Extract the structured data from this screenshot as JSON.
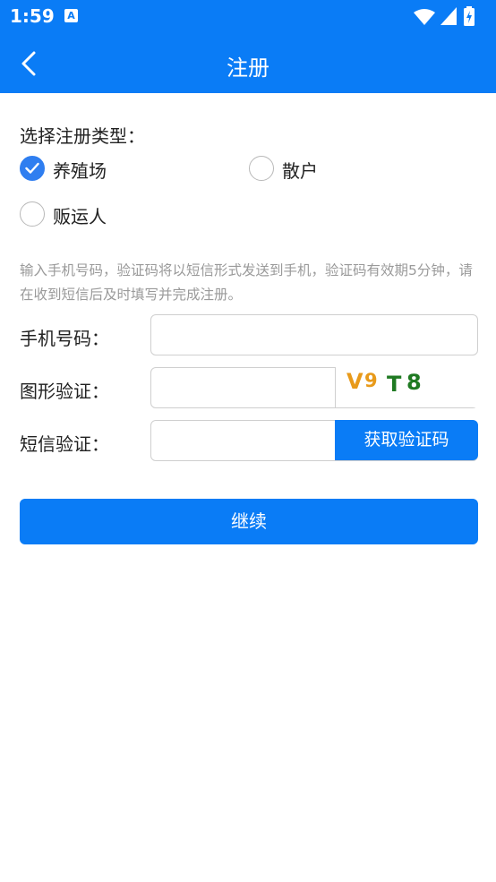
{
  "status_bar": {
    "time": "1:59",
    "notification_icon": "a-icon"
  },
  "header": {
    "title": "注册",
    "back_icon": "chevron-left-icon"
  },
  "registration_type": {
    "label": "选择注册类型：",
    "options": [
      {
        "label": "养殖场",
        "checked": true
      },
      {
        "label": "散户",
        "checked": false
      },
      {
        "label": "贩运人",
        "checked": false
      }
    ]
  },
  "hint": "输入手机号码，验证码将以短信形式发送到手机，验证码有效期5分钟，请在收到短信后及时填写并完成注册。",
  "form": {
    "phone": {
      "label": "手机号码：",
      "value": "",
      "placeholder": ""
    },
    "captcha": {
      "label": "图形验证：",
      "value": "",
      "placeholder": "",
      "image_text": [
        "V",
        "9",
        "T",
        "8"
      ]
    },
    "sms": {
      "label": "短信验证：",
      "value": "",
      "placeholder": "",
      "button": "获取验证码"
    }
  },
  "continue_button": "继续",
  "colors": {
    "primary": "#0a7cf6",
    "checked": "#2f7ef0",
    "hint": "#9a9a9a"
  }
}
